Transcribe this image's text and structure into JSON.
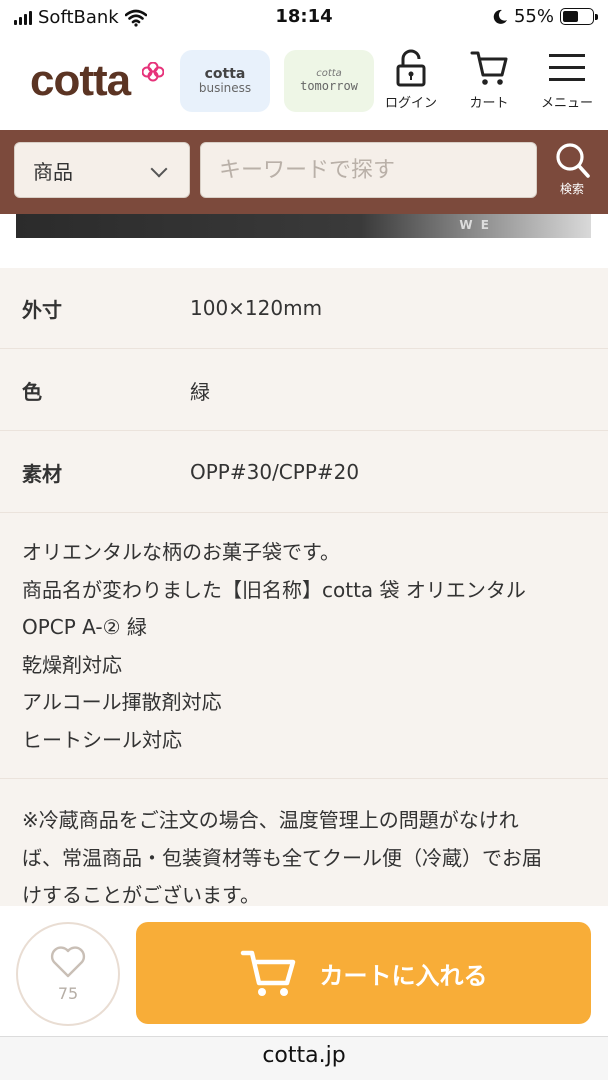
{
  "status_bar": {
    "carrier": "SoftBank",
    "time": "18:14",
    "battery": "55%",
    "battery_level": 0.55
  },
  "header": {
    "logo": "cotta",
    "business_pill": {
      "line1": "cotta",
      "line2": "business"
    },
    "tomorrow_pill": {
      "line1": "cotta",
      "line2": "tomorrow"
    },
    "login_label": "ログイン",
    "cart_label": "カート",
    "menu_label": "メニュー"
  },
  "search": {
    "category": "商品",
    "placeholder": "キーワードで探す",
    "button_label": "検索"
  },
  "specs": [
    {
      "label": "外寸",
      "value": "100×120mm"
    },
    {
      "label": "色",
      "value": "緑"
    },
    {
      "label": "素材",
      "value": "OPP#30/CPP#20"
    }
  ],
  "description": [
    "オリエンタルな柄のお菓子袋です。",
    "商品名が変わりました【旧名称】cotta 袋 オリエンタル",
    "OPCP A-② 緑",
    "乾燥剤対応",
    "アルコール揮散剤対応",
    "ヒートシール対応"
  ],
  "note": [
    "※冷蔵商品をご注文の場合、温度管理上の問題がなけれ",
    "ば、常温商品・包装資材等も全てクール便（冷蔵）でお届",
    "けすることがございます。"
  ],
  "actions": {
    "favorite_count": "75",
    "add_to_cart_label": "カートに入れる"
  },
  "browser": {
    "url": "cotta.jp"
  },
  "colors": {
    "brand_brown": "#7c4a3c",
    "cart_orange": "#f8ad38",
    "logo_pink": "#e6337a"
  }
}
